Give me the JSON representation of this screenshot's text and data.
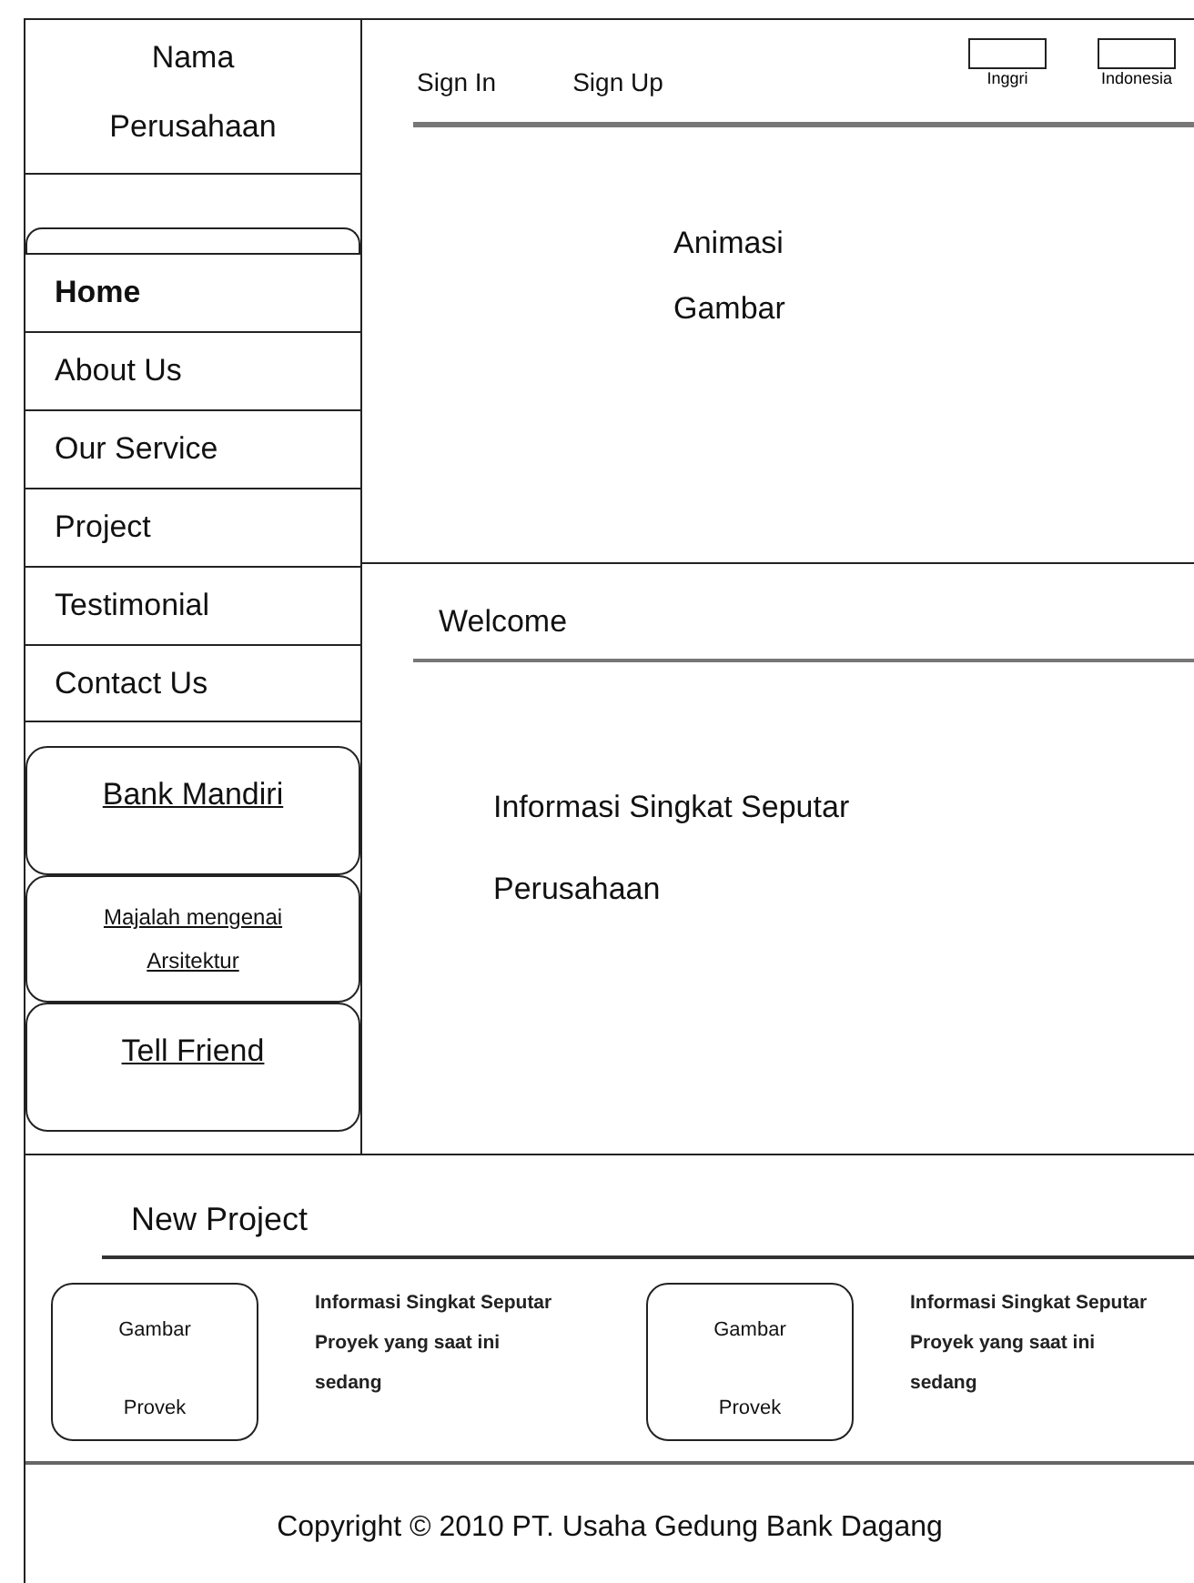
{
  "logo": "Nama Perusahaan",
  "header_links": [
    {
      "label": "Sign In"
    },
    {
      "label": "Sign Up"
    }
  ],
  "languages": [
    {
      "label": "Inggri"
    },
    {
      "label": "Indonesia"
    }
  ],
  "banner": "Animasi Gambar",
  "menu": {
    "items": [
      {
        "label": "Home",
        "selected": true
      },
      {
        "label": "About Us",
        "selected": false
      },
      {
        "label": "Our Service",
        "selected": false
      },
      {
        "label": "Project",
        "selected": false
      },
      {
        "label": "Testimonial",
        "selected": false
      },
      {
        "label": "Contact Us",
        "selected": false
      }
    ]
  },
  "side_links": [
    {
      "label": "Bank Mandiri",
      "kind": "large"
    },
    {
      "label": "Majalah mengenai Arsitektur",
      "kind": "small"
    },
    {
      "label": "Tell Friend",
      "kind": "large"
    }
  ],
  "welcome": {
    "title": "Welcome",
    "text": "Informasi Singkat Seputar Perusahaan"
  },
  "new_project": {
    "title": "New Project",
    "items": [
      {
        "image_label": "Gambar Provek",
        "text": "Informasi Singkat Seputar Proyek yang saat ini sedang"
      },
      {
        "image_label": "Gambar Provek",
        "text": "Informasi Singkat Seputar Proyek yang saat ini sedang"
      }
    ]
  },
  "footer": "Copyright © 2010 PT. Usaha Gedung Bank Dagang"
}
